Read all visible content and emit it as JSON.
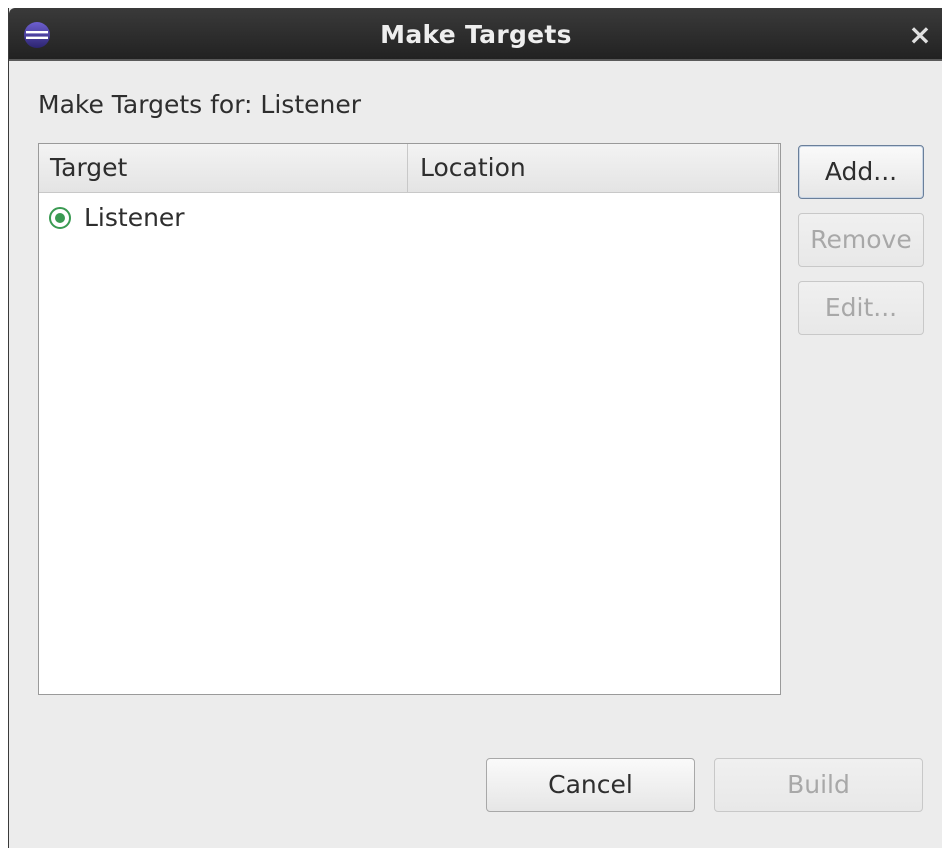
{
  "window": {
    "title": "Make Targets",
    "close_glyph": "×",
    "app_icon": "eclipse-icon"
  },
  "heading": "Make Targets for: Listener",
  "table": {
    "columns": [
      "Target",
      "Location"
    ],
    "rows": [
      {
        "target": "Listener",
        "location": "",
        "icon": "make-target-icon"
      }
    ]
  },
  "side_buttons": {
    "add": "Add...",
    "remove": "Remove",
    "edit": "Edit..."
  },
  "footer_buttons": {
    "cancel": "Cancel",
    "build": "Build"
  },
  "colors": {
    "titlebar": "#2c2c2c",
    "dialog_bg": "#ececec",
    "target_icon": "#3a9a52"
  }
}
